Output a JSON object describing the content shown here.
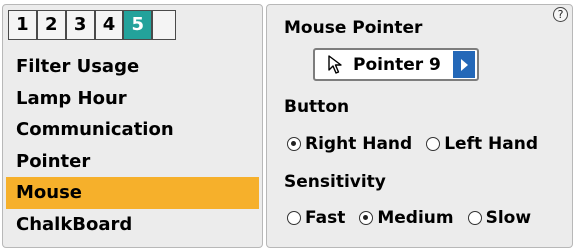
{
  "tabs": [
    "1",
    "2",
    "3",
    "4",
    "5"
  ],
  "active_tab": "5",
  "menu": {
    "items": [
      {
        "label": "Filter Usage"
      },
      {
        "label": "Lamp Hour"
      },
      {
        "label": "Communication"
      },
      {
        "label": "Pointer"
      },
      {
        "label": "Mouse",
        "selected": true
      },
      {
        "label": "ChalkBoard"
      }
    ]
  },
  "settings": {
    "help_icon_glyph": "?",
    "mouse_pointer": {
      "label": "Mouse Pointer",
      "value": "Pointer 9",
      "icon": "arrow-cursor-icon"
    },
    "button": {
      "label": "Button",
      "options": [
        {
          "label": "Right Hand",
          "checked": true
        },
        {
          "label": "Left Hand",
          "checked": false
        }
      ]
    },
    "sensitivity": {
      "label": "Sensitivity",
      "options": [
        {
          "label": "Fast",
          "checked": false
        },
        {
          "label": "Medium",
          "checked": true
        },
        {
          "label": "Slow",
          "checked": false
        }
      ]
    }
  },
  "colors": {
    "active_tab": "#23a29b",
    "selected_item": "#f6b02b",
    "select_arrow": "#2468b8"
  }
}
